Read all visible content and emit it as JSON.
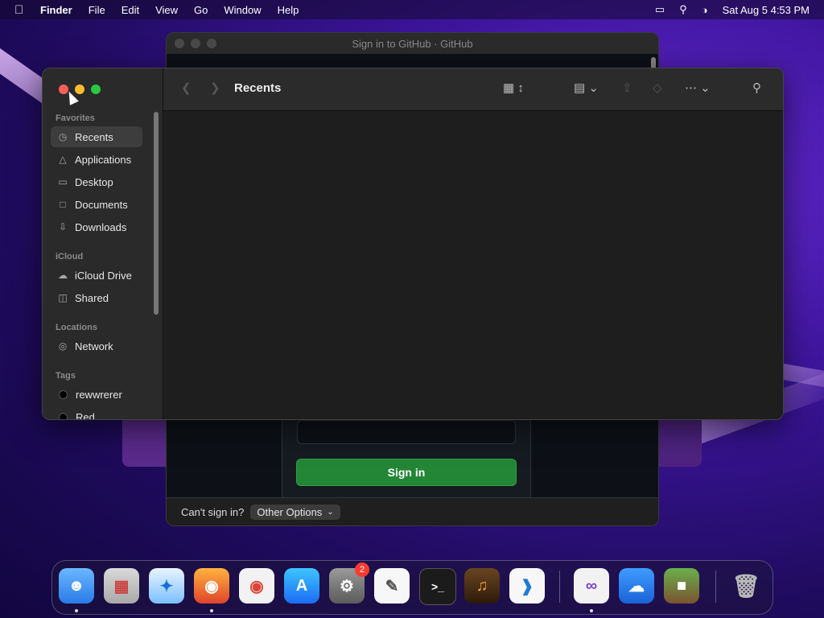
{
  "menubar": {
    "app": "Finder",
    "items": [
      "File",
      "Edit",
      "View",
      "Go",
      "Window",
      "Help"
    ],
    "datetime": "Sat Aug 5  4:53 PM"
  },
  "github_window": {
    "title": "Sign in to GitHub · GitHub",
    "signin_button": "Sign in",
    "footer_label": "Can't sign in?",
    "options_label": "Other Options"
  },
  "finder": {
    "title": "Recents",
    "sidebar": {
      "favorites_header": "Favorites",
      "favorites": [
        {
          "label": "Recents",
          "icon": "clock-icon"
        },
        {
          "label": "Applications",
          "icon": "applications-icon"
        },
        {
          "label": "Desktop",
          "icon": "desktop-icon"
        },
        {
          "label": "Documents",
          "icon": "document-icon"
        },
        {
          "label": "Downloads",
          "icon": "download-icon"
        }
      ],
      "icloud_header": "iCloud",
      "icloud": [
        {
          "label": "iCloud Drive",
          "icon": "cloud-icon"
        },
        {
          "label": "Shared",
          "icon": "shared-folder-icon"
        }
      ],
      "locations_header": "Locations",
      "locations": [
        {
          "label": "Network",
          "icon": "globe-icon"
        }
      ],
      "tags_header": "Tags",
      "tags": [
        {
          "label": "rewwrerer",
          "color": "#000000"
        },
        {
          "label": "Red",
          "color": "#000000"
        }
      ]
    }
  },
  "dock": {
    "settings_badge": "2",
    "apps": [
      "finder",
      "launchpad",
      "safari",
      "firefox",
      "chrome",
      "app-store",
      "system-settings",
      "textedit",
      "terminal",
      "garageband",
      "vscode",
      "visual-studio",
      "weather",
      "minecraft",
      "trash"
    ]
  }
}
